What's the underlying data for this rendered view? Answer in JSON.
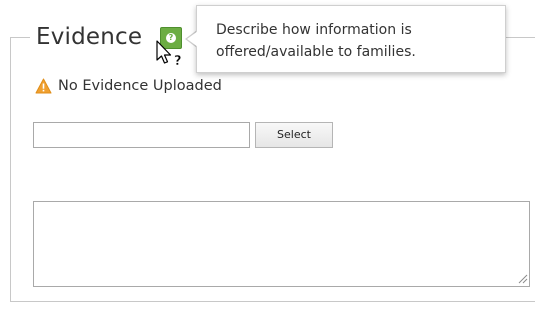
{
  "section": {
    "legend": "Evidence",
    "help_icon": "question-mark-icon",
    "help_glyph": "?"
  },
  "tooltip": {
    "text": "Describe how information is offered/available to families."
  },
  "status": {
    "icon": "warning-icon",
    "text": "No Evidence Uploaded",
    "color": "#f0a030"
  },
  "upload": {
    "file_value": "",
    "select_label": "Select"
  },
  "comment": {
    "value": ""
  },
  "colors": {
    "help_icon_bg": "#6cad43",
    "border": "#c8c8c8"
  }
}
